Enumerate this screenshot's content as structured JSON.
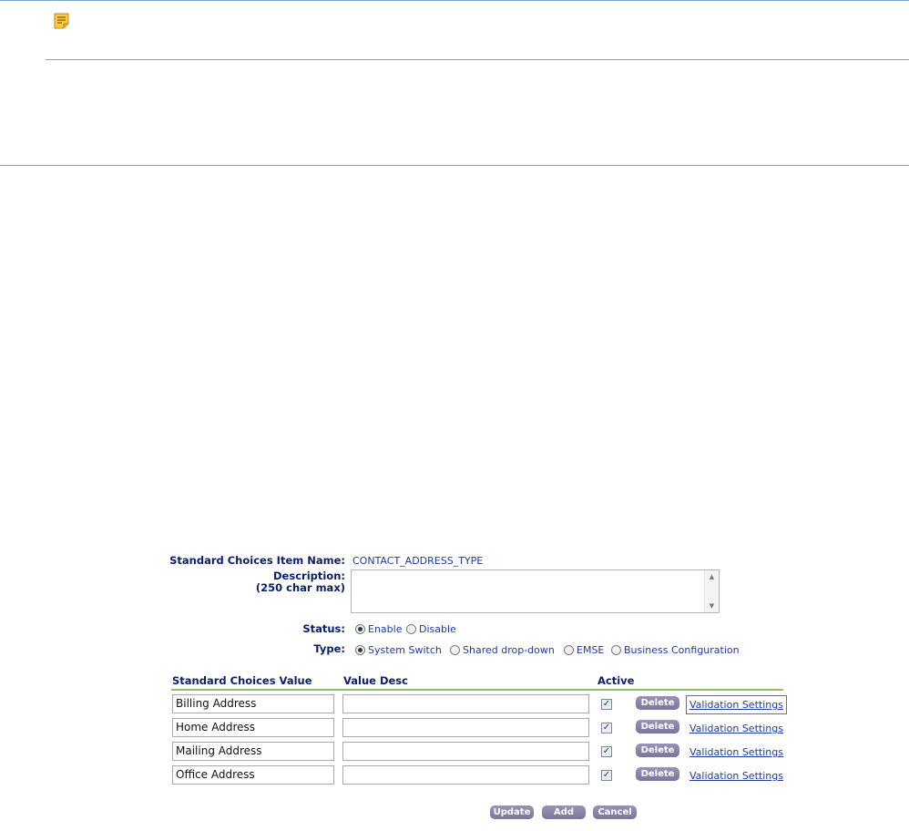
{
  "note_icon": "note-icon",
  "form": {
    "item_name_label": "Standard Choices Item Name:",
    "item_name_value": "CONTACT_ADDRESS_TYPE",
    "description_label": "Description:",
    "description_hint": "(250 char max)",
    "description_value": "",
    "status_label": "Status:",
    "status_options": [
      {
        "label": "Enable",
        "selected": true
      },
      {
        "label": "Disable",
        "selected": false
      }
    ],
    "type_label": "Type:",
    "type_options": [
      {
        "label": "System Switch",
        "selected": true
      },
      {
        "label": "Shared drop-down",
        "selected": false
      },
      {
        "label": "EMSE",
        "selected": false
      },
      {
        "label": "Business Configuration",
        "selected": false
      }
    ]
  },
  "table": {
    "headers": {
      "value": "Standard Choices Value",
      "desc": "Value Desc",
      "active": "Active"
    },
    "rows": [
      {
        "value": "Billing Address",
        "desc": "",
        "active": true,
        "delete_label": "Delete",
        "link_label": "Validation Settings"
      },
      {
        "value": "Home Address",
        "desc": "",
        "active": true,
        "delete_label": "Delete",
        "link_label": "Validation Settings"
      },
      {
        "value": "Mailing Address",
        "desc": "",
        "active": true,
        "delete_label": "Delete",
        "link_label": "Validation Settings"
      },
      {
        "value": "Office Address",
        "desc": "",
        "active": true,
        "delete_label": "Delete",
        "link_label": "Validation Settings"
      }
    ]
  },
  "footer_buttons": {
    "update": "Update",
    "add": "Add",
    "cancel": "Cancel"
  },
  "colors": {
    "label_navy": "#0a1f6b",
    "link_blue": "#1f3aa0",
    "header_rule_green": "#8dc35a",
    "button_purple": "#857d9f",
    "focus_outline": "#d84a2a"
  }
}
